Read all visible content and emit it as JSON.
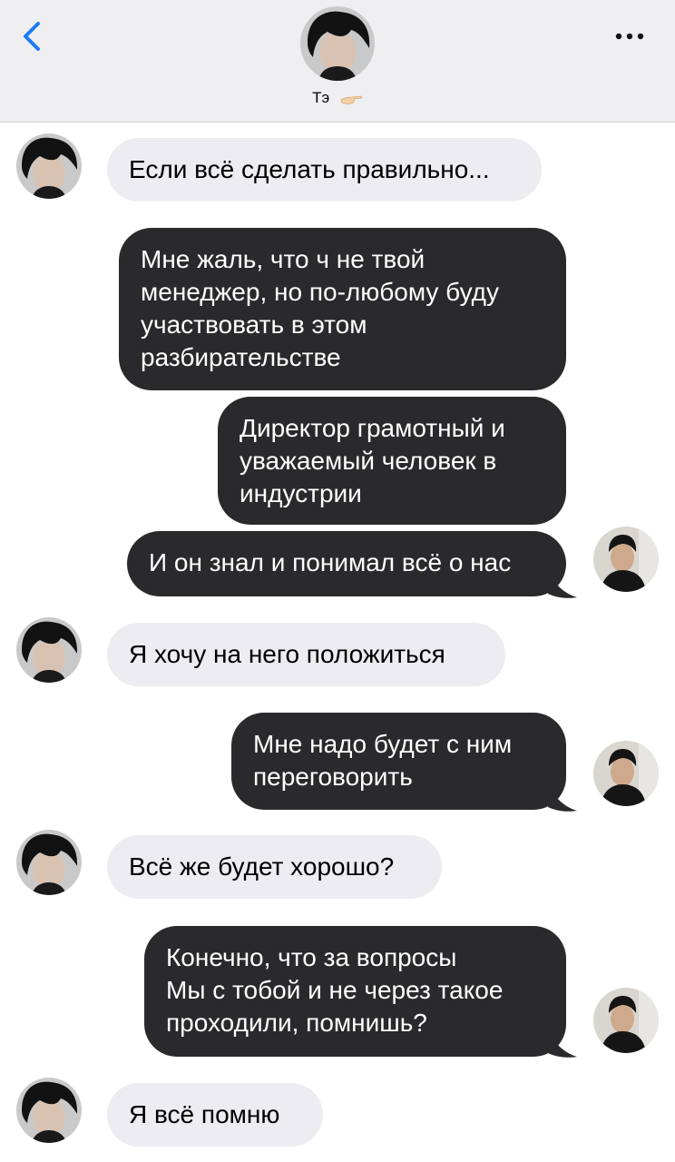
{
  "header": {
    "contact_name": "Тэ",
    "back_icon": "chevron-left-icon",
    "more_icon": "ellipsis-icon",
    "accent": "#1c7cf3"
  },
  "messages": [
    {
      "side": "in",
      "text": "Если всё сделать правильно..."
    },
    {
      "side": "out",
      "text": "Мне жаль, что ч не твой менеджер, но по-любому буду участвовать в этом разбирательстве"
    },
    {
      "side": "out",
      "text": "Директор грамотный и уважаемый человек в индустрии"
    },
    {
      "side": "out",
      "text": "И он знал и понимал всё о нас"
    },
    {
      "side": "in",
      "text": "Я хочу на него положиться"
    },
    {
      "side": "out",
      "text": "Мне надо будет с ним переговорить"
    },
    {
      "side": "in",
      "text": "Всё же будет хорошо?"
    },
    {
      "side": "out",
      "text": "Конечно, что за вопросы\nМы с тобой и не через такое проходили, помнишь?"
    },
    {
      "side": "in",
      "text": "Я всё помню"
    }
  ],
  "colors": {
    "incoming_bubble": "#ececf1",
    "outgoing_bubble": "#2a2a2c",
    "header_bg": "#efeff1"
  }
}
